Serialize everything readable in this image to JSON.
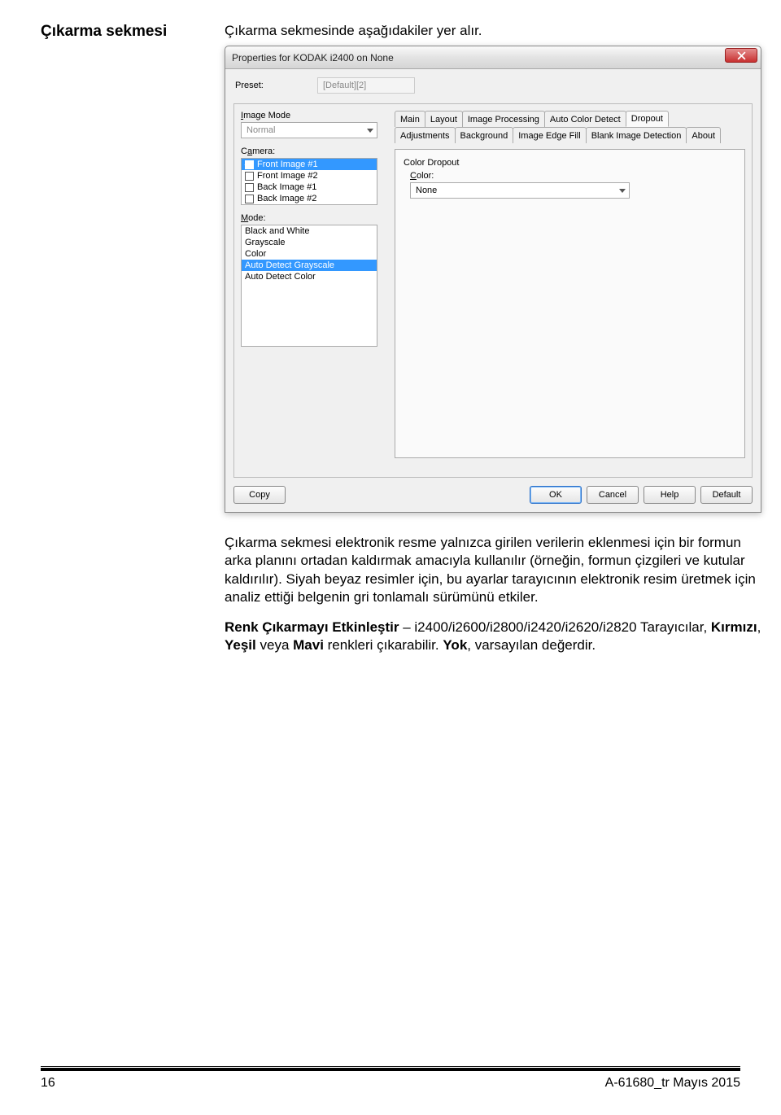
{
  "heading": "Çıkarma sekmesi",
  "intro": "Çıkarma sekmesinde aşağıdakiler yer alır.",
  "dialog": {
    "title": "Properties for KODAK i2400 on None",
    "preset_label": "Preset:",
    "preset_value": "[Default][2]",
    "image_mode_label": "Image Mode",
    "image_mode_value": "Normal",
    "camera_label": "Camera:",
    "camera_items": [
      {
        "label": "Front Image #1",
        "checked": true,
        "selected": true
      },
      {
        "label": "Front Image #2",
        "checked": false,
        "selected": false
      },
      {
        "label": "Back Image #1",
        "checked": false,
        "selected": false
      },
      {
        "label": "Back Image #2",
        "checked": false,
        "selected": false
      }
    ],
    "mode_label": "Mode:",
    "mode_items": [
      {
        "label": "Black and White",
        "selected": false,
        "dim": false
      },
      {
        "label": "Grayscale",
        "selected": false,
        "dim": false
      },
      {
        "label": "Color",
        "selected": false,
        "dim": false
      },
      {
        "label": "Auto Detect Grayscale",
        "selected": true,
        "dim": true
      },
      {
        "label": "Auto Detect Color",
        "selected": false,
        "dim": false
      }
    ],
    "tabs_row1": [
      "Adjustments",
      "Background",
      "Image Edge Fill",
      "Blank Image Detection",
      "About"
    ],
    "tabs_row2": [
      "Main",
      "Layout",
      "Image Processing",
      "Auto Color Detect",
      "Dropout"
    ],
    "active_tab": "Dropout",
    "group_title": "Color Dropout",
    "color_label": "Color:",
    "color_value": "None",
    "buttons": {
      "copy": "Copy",
      "ok": "OK",
      "cancel": "Cancel",
      "help": "Help",
      "default": "Default"
    }
  },
  "para1_a": "Çıkarma sekmesi elektronik resme yalnızca girilen verilerin eklenmesi için bir formun arka planını ortadan kaldırmak amacıyla kullanılır (örneğin, formun çizgileri ve kutular kaldırılır). Siyah beyaz resimler için, bu ayarlar tarayıcının elektronik resim üretmek için analiz ettiği belgenin gri tonlamalı sürümünü etkiler.",
  "para2_b1": "Renk Çıkarmayı Etkinleştir",
  "para2_mid": " – i2400/i2600/i2800/i2420/i2620/i2820 Tarayıcılar, ",
  "para2_b2": "Kırmızı",
  "para2_c": ", ",
  "para2_b3": "Yeşil",
  "para2_or": " veya ",
  "para2_b4": "Mavi",
  "para2_tail1": " renkleri çıkarabilir. ",
  "para2_b5": "Yok",
  "para2_tail2": ", varsayılan değerdir.",
  "footer": {
    "page": "16",
    "doc": "A-61680_tr  Mayıs 2015"
  }
}
